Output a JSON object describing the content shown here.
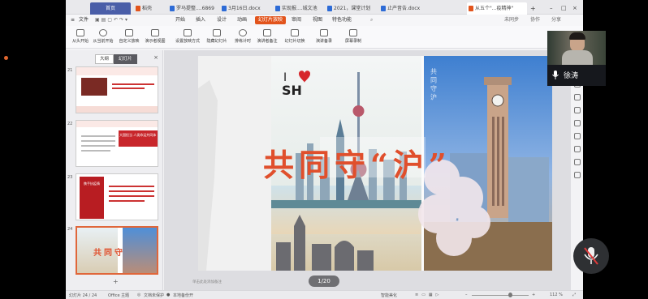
{
  "window": {
    "home_tab": "首页",
    "tabs": [
      {
        "label": "稻壳",
        "icon_color": "#e2541c"
      },
      {
        "label": "罗马提整....6869",
        "icon_color": "#2d6bd6"
      },
      {
        "label": "3月16日.docx",
        "icon_color": "#2d6bd6"
      },
      {
        "label": "实现报....城文池",
        "icon_color": "#2d6bd6"
      },
      {
        "label": "2021，课堂计划",
        "icon_color": "#2d6bd6"
      },
      {
        "label": "止产音告.docx",
        "icon_color": "#2d6bd6"
      },
      {
        "label": "从五个\"...疫精神\"",
        "icon_color": "#e2541c"
      }
    ],
    "new_tab": "+"
  },
  "menu": {
    "file": "文件",
    "items": [
      "开始",
      "插入",
      "设计",
      "动画",
      "幻灯片放映",
      "审阅",
      "视图",
      "特色功能"
    ],
    "active": "幻灯片放映",
    "share": "未同步",
    "comment": "协作",
    "share2": "分享"
  },
  "ribbon": {
    "items": [
      "从头开始",
      "从当前开始",
      "自定义放映",
      "演示者视图",
      "设置放映方式",
      "隐藏幻灯片",
      "排练计时",
      "演讲者备注",
      "幻灯片切换",
      "演讲备录",
      "屏幕录制"
    ]
  },
  "panel": {
    "tab_outline": "大纲",
    "tab_slides": "幻灯片",
    "thumbs": [
      {
        "num": "21"
      },
      {
        "num": "22",
        "banner": "大国担当 人类命运共同体"
      },
      {
        "num": "23",
        "title": "携手抗疫情"
      },
      {
        "num": "24"
      }
    ],
    "add": "+"
  },
  "slide": {
    "logo_i": "I",
    "logo_sh": "SH",
    "headline": "共同守“沪”",
    "watermark": "共 同 守 沪",
    "notes_placeholder": "单击此处添加备注"
  },
  "page_indicator": "1/20",
  "status": {
    "slide_count": "幻灯片 24 / 24",
    "theme": "Office 主题",
    "protect": "文档未保护",
    "backup": "本地备份开",
    "smart": "智能美化",
    "zoom": "112 %"
  },
  "participant": {
    "name": "徐涛"
  },
  "colors": {
    "accent": "#e2541c",
    "home_tab": "#4a5ea8",
    "headline": "#e04f2c"
  }
}
